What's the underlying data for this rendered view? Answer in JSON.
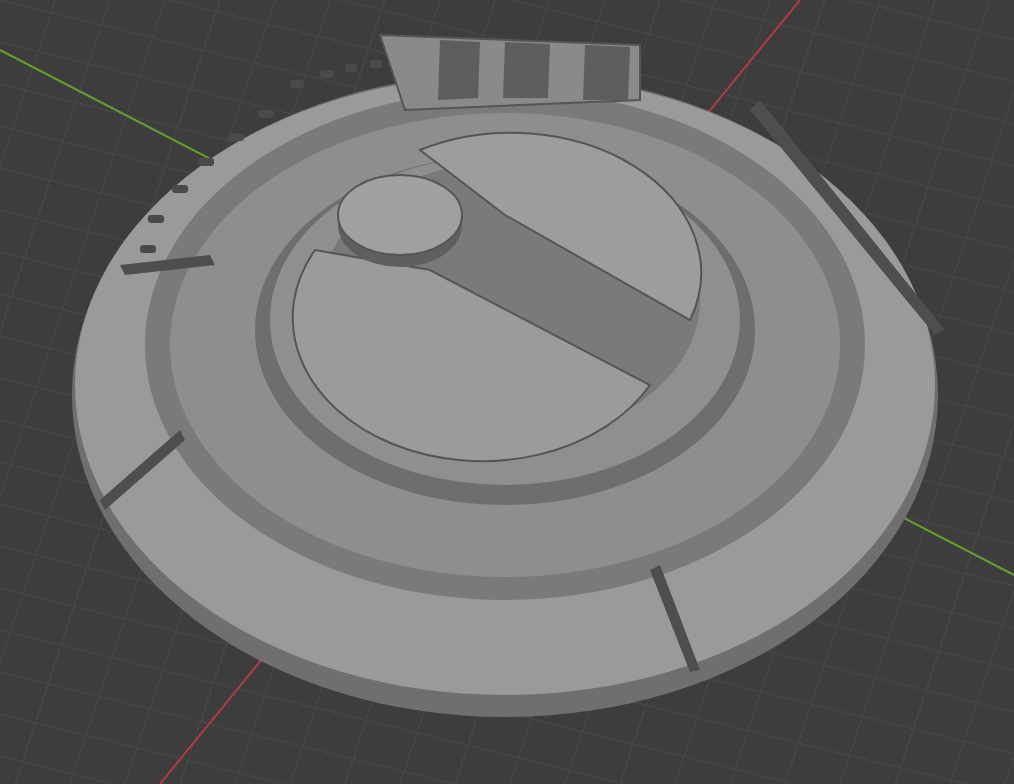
{
  "viewport": {
    "grid": true,
    "x_axis": true,
    "y_axis": true
  }
}
